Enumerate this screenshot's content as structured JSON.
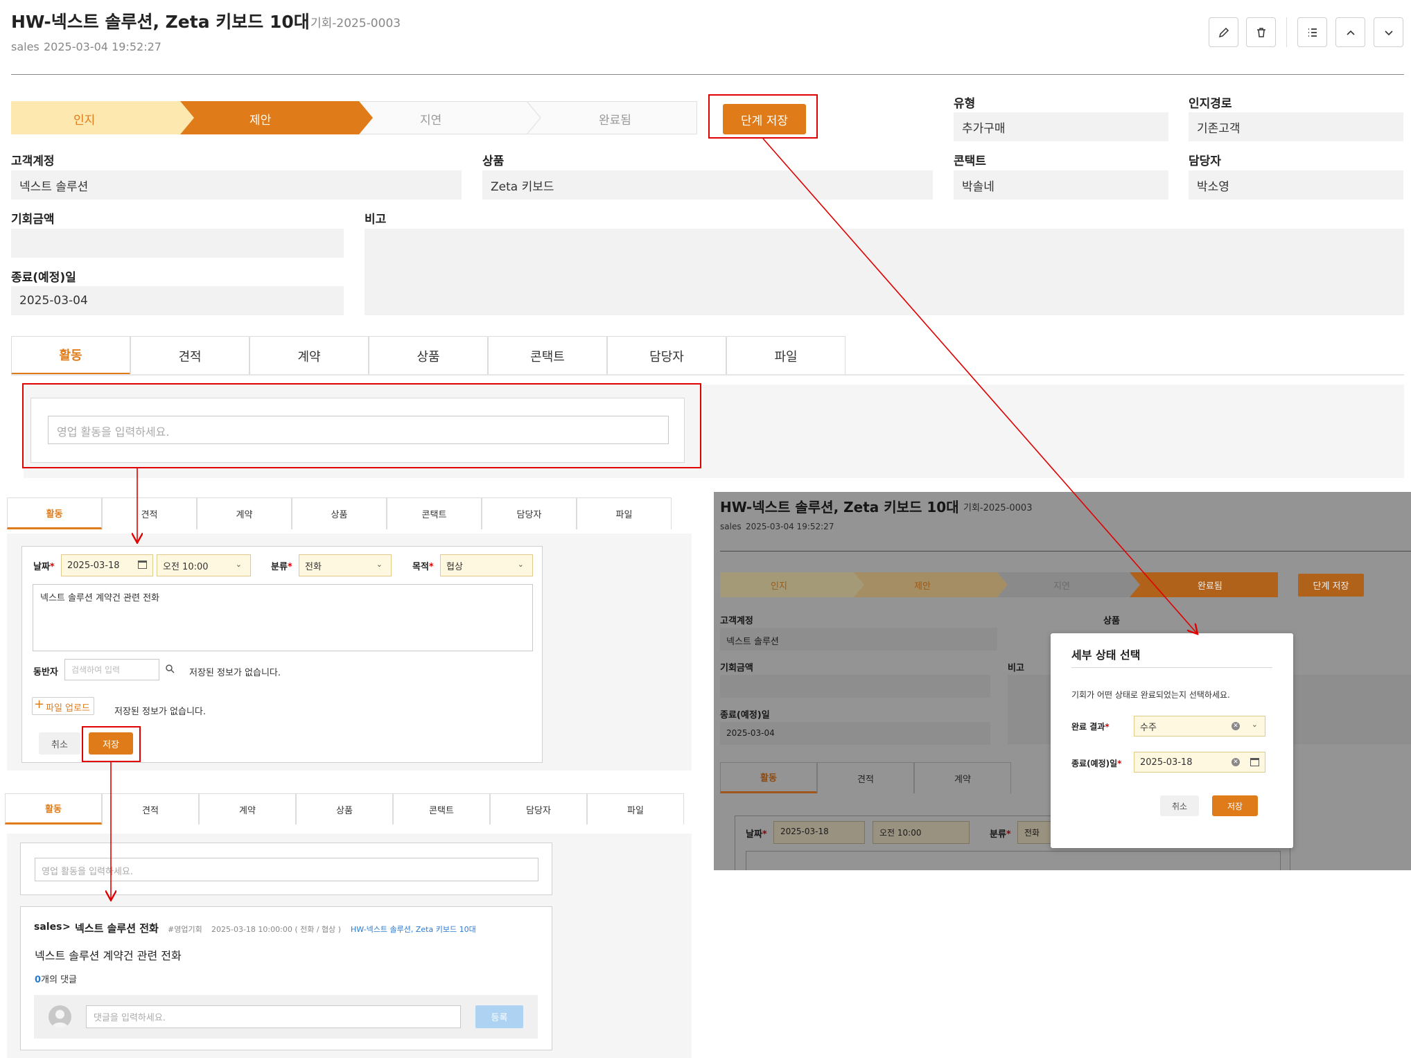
{
  "header": {
    "title": "HW-넥스트 솔루션, Zeta 키보드 10대",
    "code": "기회-2025-0003",
    "owner": "sales",
    "datetime": "2025-03-04 19:52:27"
  },
  "stages": {
    "items": [
      "인지",
      "제안",
      "지연",
      "완료됨"
    ],
    "current": "제안",
    "save_label": "단계 저장"
  },
  "fields": {
    "type_label": "유형",
    "type_value": "추가구매",
    "source_label": "인지경로",
    "source_value": "기존고객",
    "account_label": "고객계정",
    "account_value": "넥스트 솔루션",
    "product_label": "상품",
    "product_value": "Zeta 키보드",
    "contact_label": "콘택트",
    "contact_value": "박솔네",
    "manager_label": "담당자",
    "manager_value": "박소영",
    "amount_label": "기회금액",
    "amount_value": "",
    "note_label": "비고",
    "note_value": "",
    "end_label": "종료(예정)일",
    "end_value": "2025-03-04"
  },
  "tabs": [
    "활동",
    "견적",
    "계약",
    "상품",
    "콘택트",
    "담당자",
    "파일"
  ],
  "activity": {
    "placeholder": "영업 활동을 입력하세요."
  },
  "activity_form": {
    "date_label": "날짜",
    "date_value": "2025-03-18",
    "time_value": "오전 10:00",
    "category_label": "분류",
    "category_value": "전화",
    "purpose_label": "목적",
    "purpose_value": "협상",
    "content": "넥스트 솔루션 계약건 관련 전화",
    "companion_label": "동반자",
    "companion_placeholder": "검색하여 입력",
    "no_info": "저장된 정보가 없습니다.",
    "upload_label": "파일 업로드",
    "cancel_label": "취소",
    "save_label": "저장"
  },
  "activity_result": {
    "owner": "sales",
    "sep": ">",
    "title": "넥스트 솔루션 전화",
    "tag": "#영업기회",
    "meta": "2025-03-18 10:00:00 ( 전화 / 협상 )",
    "link": "HW-넥스트 솔루션, Zeta 키보드 10대",
    "body": "넥스트 솔루션 계약건 관련 전화",
    "comment_count": "0",
    "comment_suffix": "개의 댓글",
    "comment_placeholder": "댓글을 입력하세요.",
    "register_label": "등록"
  },
  "modal_bg": {
    "title": "HW-넥스트 솔루션, Zeta 키보드 10대",
    "code": "기회-2025-0003",
    "owner": "sales",
    "datetime": "2025-03-04 19:52:27",
    "stages": [
      "인지",
      "제안",
      "지연",
      "완료됨"
    ],
    "save_label": "단계 저장",
    "account_label": "고객계정",
    "account_value": "넥스트 솔루션",
    "product_label": "상품",
    "amount_label": "기회금액",
    "note_label": "비고",
    "end_label": "종료(예정)일",
    "end_value": "2025-03-04",
    "tabs": [
      "활동",
      "견적",
      "계약"
    ],
    "date_label": "날짜",
    "date_value": "2025-03-18",
    "time_value": "오전 10:00",
    "category_label": "분류",
    "category_value": "전화"
  },
  "modal": {
    "title": "세부 상태 선택",
    "description": "기회가 어떤 상태로 완료되었는지 선택하세요.",
    "result_label": "완료 결과",
    "result_value": "수주",
    "end_label": "종료(예정)일",
    "end_value": "2025-03-18",
    "cancel_label": "취소",
    "save_label": "저장"
  },
  "colors": {
    "accent": "#e07b1a",
    "stage_light": "#fde9b0",
    "annotation": "#e00000",
    "link": "#2a7bd0"
  }
}
